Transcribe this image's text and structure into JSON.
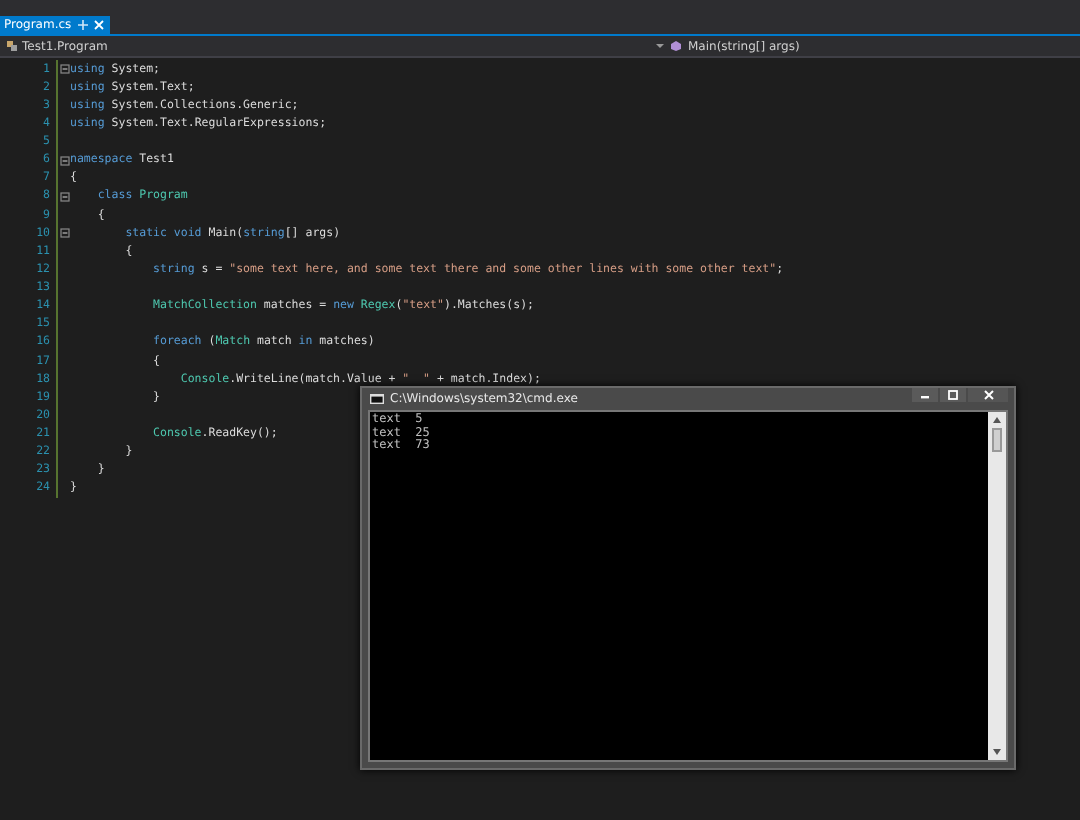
{
  "tabs": [
    {
      "label": "Program.cs",
      "selected": true
    }
  ],
  "nav_bar": {
    "type_selector": "Test1.Program",
    "member_selector": "Main(string[] args)"
  },
  "editor": {
    "lines": [
      {
        "number": "1",
        "fold": true,
        "tokens": [
          {
            "kind": "keyword",
            "text": "using"
          },
          {
            "kind": "plain",
            "text": " System;"
          }
        ]
      },
      {
        "number": "2",
        "fold": false,
        "tokens": [
          {
            "kind": "keyword",
            "text": "using"
          },
          {
            "kind": "plain",
            "text": " System.Text;"
          }
        ]
      },
      {
        "number": "3",
        "fold": false,
        "tokens": [
          {
            "kind": "keyword",
            "text": "using"
          },
          {
            "kind": "plain",
            "text": " System.Collections.Generic;"
          }
        ]
      },
      {
        "number": "4",
        "fold": false,
        "tokens": [
          {
            "kind": "keyword",
            "text": "using"
          },
          {
            "kind": "plain",
            "text": " System.Text.RegularExpressions;"
          }
        ]
      },
      {
        "number": "5",
        "fold": false
      },
      {
        "number": "6",
        "fold": true,
        "tokens": [
          {
            "kind": "keyword",
            "text": "namespace"
          },
          {
            "kind": "plain",
            "text": " Test1"
          }
        ]
      },
      {
        "number": "7",
        "fold": false,
        "tokens": [
          {
            "kind": "plain",
            "text": "{"
          }
        ]
      },
      {
        "number": "8",
        "fold": true,
        "tokens": [
          {
            "kind": "keyword",
            "text": "    class "
          },
          {
            "kind": "type",
            "text": "Program"
          }
        ]
      },
      {
        "number": "9",
        "fold": false,
        "tokens": [
          {
            "kind": "plain",
            "text": "    {"
          }
        ]
      },
      {
        "number": "10",
        "fold": true,
        "tokens": [
          {
            "kind": "keyword",
            "text": "        static void"
          },
          {
            "kind": "plain",
            "text": " Main("
          },
          {
            "kind": "keyword",
            "text": "string"
          },
          {
            "kind": "plain",
            "text": "[] args)"
          }
        ]
      },
      {
        "number": "11",
        "fold": false,
        "tokens": [
          {
            "kind": "plain",
            "text": "        {"
          }
        ]
      },
      {
        "number": "12",
        "fold": false,
        "tokens": [
          {
            "kind": "keyword",
            "text": "            string"
          },
          {
            "kind": "plain",
            "text": " s = "
          },
          {
            "kind": "string",
            "text": "\"some text here, and some text there and some other lines with some other text\""
          },
          {
            "kind": "plain",
            "text": ";"
          }
        ]
      },
      {
        "number": "13",
        "fold": false
      },
      {
        "number": "14",
        "fold": false,
        "tokens": [
          {
            "kind": "type",
            "text": "            MatchCollection"
          },
          {
            "kind": "plain",
            "text": " matches = "
          },
          {
            "kind": "keyword",
            "text": "new "
          },
          {
            "kind": "type",
            "text": "Regex"
          },
          {
            "kind": "plain",
            "text": "("
          },
          {
            "kind": "string",
            "text": "\"text\""
          },
          {
            "kind": "plain",
            "text": ").Matches(s);"
          }
        ]
      },
      {
        "number": "15",
        "fold": false
      },
      {
        "number": "16",
        "fold": false,
        "tokens": [
          {
            "kind": "keyword",
            "text": "            foreach"
          },
          {
            "kind": "plain",
            "text": " ("
          },
          {
            "kind": "type",
            "text": "Match"
          },
          {
            "kind": "plain",
            "text": " match "
          },
          {
            "kind": "keyword",
            "text": "in"
          },
          {
            "kind": "plain",
            "text": " matches)"
          }
        ]
      },
      {
        "number": "17",
        "fold": false,
        "tokens": [
          {
            "kind": "plain",
            "text": "            {"
          }
        ]
      },
      {
        "number": "18",
        "fold": false,
        "tokens": [
          {
            "kind": "type",
            "text": "                Console"
          },
          {
            "kind": "plain",
            "text": ".WriteLine(match.Value + "
          },
          {
            "kind": "string",
            "text": "\"  \""
          },
          {
            "kind": "plain",
            "text": " + match.Index);"
          }
        ]
      },
      {
        "number": "19",
        "fold": false,
        "tokens": [
          {
            "kind": "plain",
            "text": "            }"
          }
        ]
      },
      {
        "number": "20",
        "fold": false
      },
      {
        "number": "21",
        "fold": false,
        "tokens": [
          {
            "kind": "type",
            "text": "            Console"
          },
          {
            "kind": "plain",
            "text": ".ReadKey();"
          }
        ]
      },
      {
        "number": "22",
        "fold": false,
        "tokens": [
          {
            "kind": "plain",
            "text": "        }"
          }
        ]
      },
      {
        "number": "23",
        "fold": false,
        "tokens": [
          {
            "kind": "plain",
            "text": "    }"
          }
        ]
      },
      {
        "number": "24",
        "fold": false,
        "tokens": [
          {
            "kind": "plain",
            "text": "}"
          }
        ]
      }
    ]
  },
  "console": {
    "title": "C:\\Windows\\system32\\cmd.exe",
    "lines": [
      "text  5",
      "text  25",
      "text  73"
    ]
  }
}
